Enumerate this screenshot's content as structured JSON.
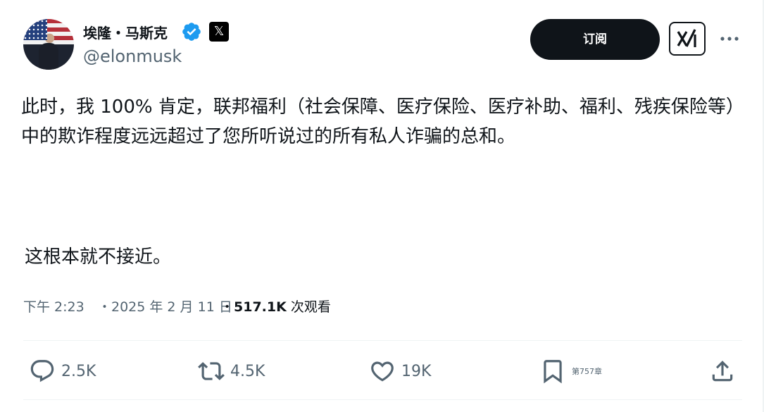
{
  "author": {
    "name": "埃隆・马斯克",
    "handle": "@elonmusk"
  },
  "header": {
    "subscribe_label": "订阅"
  },
  "tweet": {
    "text": "此时，我 100% 肯定，联邦福利（社会保障、医疗保险、医疗补助、福利、残疾保险等）中的欺诈程度远远超过了您所听说过的所有私人诈骗的总和。",
    "text2": "这根本就不接近。"
  },
  "meta": {
    "time": "下午 2:23",
    "date": "・2025 年 2 月 11 日",
    "views_count": "517.1K",
    "views_label": "次观看"
  },
  "actions": {
    "replies": "2.5K",
    "retweets": "4.5K",
    "likes": "19K",
    "bookmark_label": "第757章"
  },
  "colors": {
    "text": "#0f1419",
    "secondary": "#536471",
    "verified": "#1d9bf0",
    "button": "#0f1419"
  }
}
